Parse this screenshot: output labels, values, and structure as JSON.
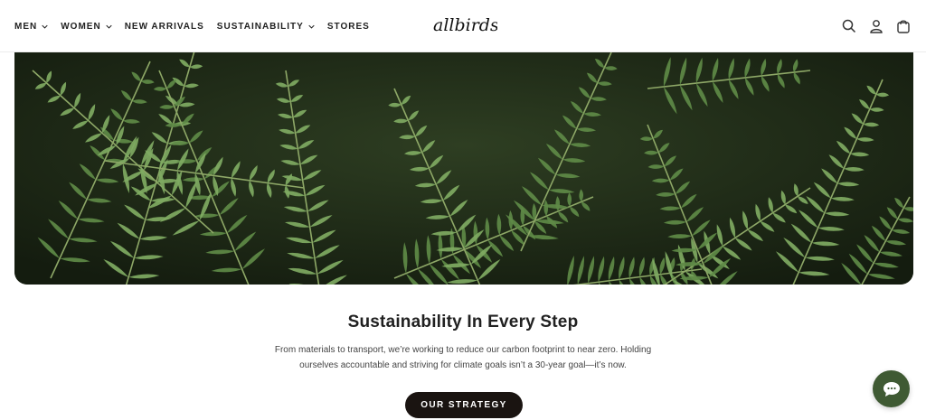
{
  "nav": {
    "items": [
      {
        "label": "MEN",
        "has_dropdown": true
      },
      {
        "label": "WOMEN",
        "has_dropdown": true
      },
      {
        "label": "NEW ARRIVALS",
        "has_dropdown": false
      },
      {
        "label": "SUSTAINABILITY",
        "has_dropdown": true
      },
      {
        "label": "STORES",
        "has_dropdown": false
      }
    ],
    "logo_text": "allbirds",
    "icons": [
      "search-icon",
      "account-icon",
      "cart-icon"
    ]
  },
  "hero": {
    "image": "fern-leaves-icon",
    "colors": {
      "dark": "#1f2a17",
      "fern": "#5e8a47",
      "fern_light": "#7faa62"
    }
  },
  "content": {
    "headline": "Sustainability In Every Step",
    "body_line1": "From materials to transport, we’re working to reduce our carbon footprint to near zero. Holding",
    "body_line2": "ourselves accountable and striving for climate goals isn’t a 30-year goal—it’s now.",
    "cta_label": "OUR STRATEGY"
  },
  "chat_widget": {
    "icon": "chat-bubble-icon",
    "color": "#3f5a33"
  }
}
